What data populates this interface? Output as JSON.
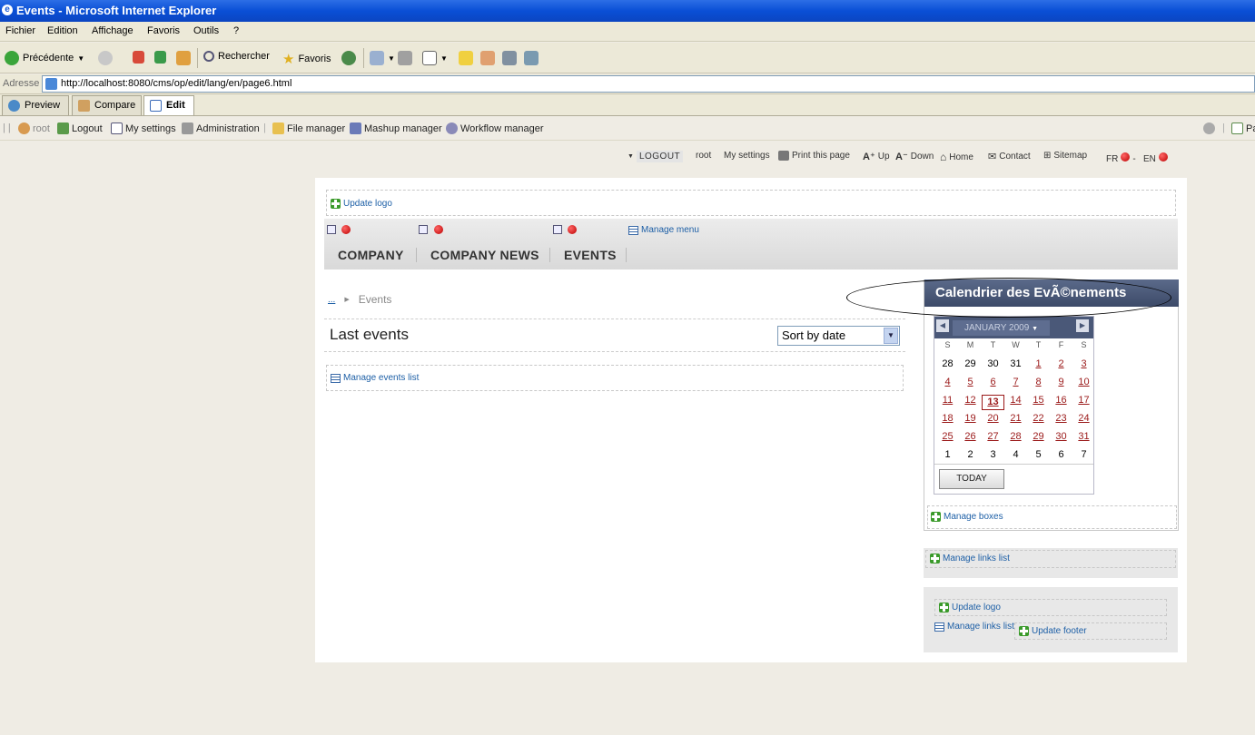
{
  "window": {
    "title": "Events - Microsoft Internet Explorer"
  },
  "menubar": {
    "items": [
      "Fichier",
      "Edition",
      "Affichage",
      "Favoris",
      "Outils",
      "?"
    ]
  },
  "toolbar": {
    "back": "Précédente",
    "search": "Rechercher",
    "favorites": "Favoris"
  },
  "address": {
    "label": "Adresse",
    "url": "http://localhost:8080/cms/op/edit/lang/en/page6.html"
  },
  "tabs": [
    "Preview",
    "Compare",
    "Edit"
  ],
  "admin": {
    "user": "root",
    "logout": "Logout",
    "settings": "My settings",
    "administration": "Administration",
    "file_manager": "File manager",
    "mashup_manager": "Mashup manager",
    "workflow_manager": "Workflow manager",
    "right_label": "Pa"
  },
  "toplinks": {
    "logout": "LOGOUT",
    "user": "root",
    "settings": "My settings",
    "print": "Print this page",
    "up": "Up",
    "down": "Down",
    "home": "Home",
    "contact": "Contact",
    "sitemap": "Sitemap",
    "fr": "FR",
    "en": "EN",
    "sep": "-"
  },
  "header": {
    "update_logo": "Update logo",
    "manage_menu": "Manage menu"
  },
  "nav": [
    "COMPANY",
    "COMPANY NEWS",
    "EVENTS"
  ],
  "breadcrumb": {
    "ellipsis": "...",
    "current": "Events"
  },
  "content": {
    "title": "Last events",
    "sort": "Sort by date",
    "manage_events": "Manage events list"
  },
  "calendar": {
    "title": "Calendrier des EvÃ©nements",
    "month": "JANUARY 2009",
    "dow": [
      "S",
      "M",
      "T",
      "W",
      "T",
      "F",
      "S"
    ],
    "weeks": [
      [
        "28",
        "29",
        "30",
        "31",
        "1",
        "2",
        "3"
      ],
      [
        "4",
        "5",
        "6",
        "7",
        "8",
        "9",
        "10"
      ],
      [
        "11",
        "12",
        "13",
        "14",
        "15",
        "16",
        "17"
      ],
      [
        "18",
        "19",
        "20",
        "21",
        "22",
        "23",
        "24"
      ],
      [
        "25",
        "26",
        "27",
        "28",
        "29",
        "30",
        "31"
      ],
      [
        "1",
        "2",
        "3",
        "4",
        "5",
        "6",
        "7"
      ]
    ],
    "today_day": "13",
    "today_button": "TODAY",
    "manage_boxes": "Manage boxes"
  },
  "right": {
    "manage_links": "Manage links list"
  },
  "footer": {
    "update_logo": "Update logo",
    "manage_links": "Manage links list",
    "update_footer": "Update footer"
  },
  "colors": {
    "calendar_header": "#3d4a68",
    "link": "#1d5fa6",
    "day_link": "#9a1818"
  }
}
